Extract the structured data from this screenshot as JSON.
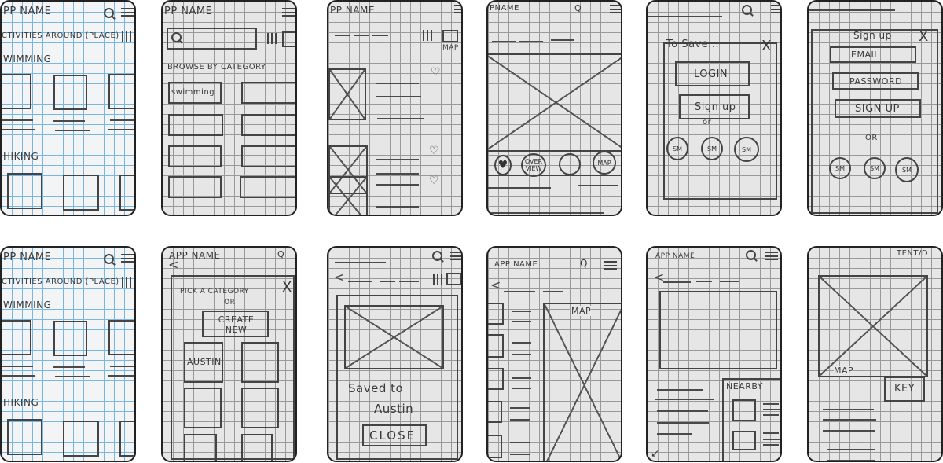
{
  "cards": {
    "c1": {
      "app": "PP NAME",
      "heading": "CTIVITIES AROUND (PLACE)",
      "section1": "WIMMING",
      "section2": "HIKING"
    },
    "c2": {
      "app": "PP NAME",
      "browse": "BROWSE BY CATEGORY",
      "cat1": "swimming"
    },
    "c3": {
      "app": "PP NAME",
      "map": "MAP"
    },
    "c4": {
      "app": "PNAME",
      "search": "Q",
      "overview": "OVER VIEW",
      "map": "MAP"
    },
    "c5": {
      "title": "To Save...",
      "close": "X",
      "login": "LOGIN",
      "signup": "Sign up",
      "or": "or",
      "sm": [
        "SM",
        "SM",
        "SM"
      ]
    },
    "c6": {
      "title": "Sign up",
      "close": "X",
      "email": "EMAIL",
      "password": "PASSWORD",
      "signup": "SIGN UP",
      "or": "OR",
      "sm": [
        "SM",
        "SM",
        "SM"
      ]
    },
    "c7": {
      "app": "PP NAME",
      "heading": "CTIVITIES AROUND (PLACE)",
      "section1": "WIMMING",
      "section2": "HIKING"
    },
    "c8": {
      "app": "APP NAME",
      "search": "Q",
      "back": "<",
      "pick": "PICK A CATEGORY",
      "or": "OR",
      "create": "CREATE NEW",
      "close": "X",
      "austin": "AUSTIN"
    },
    "c9": {
      "back": "<",
      "saved": "Saved to",
      "austin": "Austin",
      "close": "CLOSE"
    },
    "c10": {
      "app": "APP NAME",
      "search": "Q",
      "back": "<",
      "map": "MAP"
    },
    "c11": {
      "app": "APP NAME",
      "back": "<",
      "nearby": "NEARBY"
    },
    "c12": {
      "top": "TENT/D",
      "map": "MAP",
      "key": "KEY"
    }
  }
}
